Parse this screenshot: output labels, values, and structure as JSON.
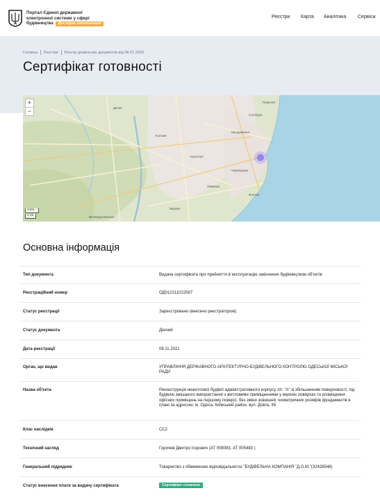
{
  "header": {
    "portal_title": "Портал Єдиної державної електронної системи у сфері будівництва",
    "test_badge": "Дослідна експлуатація",
    "nav": [
      {
        "label": "Реєстри"
      },
      {
        "label": "Карта"
      },
      {
        "label": "Аналітика"
      },
      {
        "label": "Сервіси"
      }
    ]
  },
  "breadcrumb": [
    "Головна",
    "Реєстри",
    "Реєстр дозвільних документів від 06.07.2020"
  ],
  "page_title": "Сертифікат готовності",
  "map": {
    "zoom_in": "+",
    "zoom_out": "−",
    "scale_km": "2 km",
    "scale_mi": "1 mi",
    "place_labels": [
      "Великодолинське",
      "Лиманка",
      "Таїрове",
      "Черемушки",
      "Молдаванка",
      "Слобідка",
      "Пересип",
      "Усатове",
      "Дачне",
      "Аеропорт",
      "Фонтан"
    ]
  },
  "section_title": "Основна інформація",
  "info": [
    {
      "label": "Тип документа",
      "value": "Видача сертифіката про прийняття в експлуатацію закінчених будівництвом об'єктів"
    },
    {
      "label": "Реєстраційний номер",
      "value": "ОД012211022587"
    },
    {
      "label": "Статус реєстрації",
      "value": "Зареєстровано (внесено реєстратором)"
    },
    {
      "label": "Статус документа",
      "value": "Діючий"
    },
    {
      "label": "Дата реєстрації",
      "value": "08.11.2021"
    },
    {
      "label": "Орган, що видав",
      "value": "УПРАВЛІННЯ ДЕРЖАВНОГО АРХІТЕКТУРНО-БУДІВЕЛЬНОГО КОНТРОЛЮ ОДЕСЬКОЇ МІСЬКОЇ РАДИ"
    },
    {
      "label": "Назва об'єкта",
      "value": "Реконструкція нежитлової будівлі адміністративного корпусу літ. \"А\" зі збільшенням поверховості, під будівлю змішаного використання з житловими приміщеннями у верхніх поверхах та розміщення офісних приміщень на першому поверсі, без зміни зовнішніх геометричних розмірів фундаментів в плані за адресою: м. Одеса, Київський район, вул. Довга, 39"
    },
    {
      "label": "Клас наслідків",
      "value": "СС2"
    },
    {
      "label": "Технічний нагляд",
      "value": "Горичев Дмитро Ігорович (АТ 008083, АТ 005483 )"
    },
    {
      "label": "Генеральний підрядник",
      "value": "Товариство з обмеженою відповідальністю \"БУДІВЕЛЬНА КОМПАНІЯ \"Д.О.М.\"(32428548)"
    },
    {
      "label": "Статус внесення плати за видачу сертифіката",
      "value": "Сертифікат сплачено"
    }
  ],
  "colors": {
    "accent_green": "#34a77f",
    "badge_orange": "#f4a93b",
    "hero_bg": "#e7ecf3",
    "sea": "#a8d4e6",
    "marker": "#7b6cf6"
  }
}
